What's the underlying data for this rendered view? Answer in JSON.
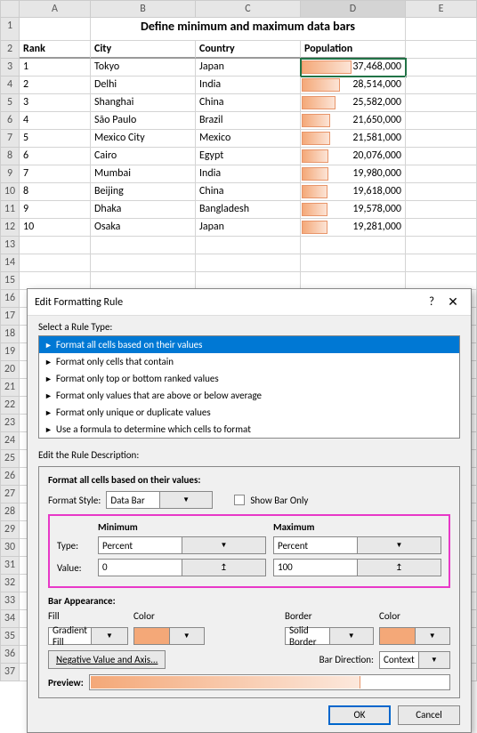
{
  "sheet": {
    "title": "Define minimum and maximum data bars",
    "cols": [
      "A",
      "B",
      "C",
      "D",
      "E"
    ],
    "headers": {
      "rank": "Rank",
      "city": "City",
      "country": "Country",
      "pop": "Population"
    },
    "rows": [
      {
        "n": "1",
        "rank": "1",
        "city": "Tokyo",
        "country": "Japan",
        "pop": "37,468,000",
        "bar": 100
      },
      {
        "n": "2",
        "rank": "2",
        "city": "Delhi",
        "country": "India",
        "pop": "28,514,000",
        "bar": 76
      },
      {
        "n": "3",
        "rank": "3",
        "city": "Shanghai",
        "country": "China",
        "pop": "25,582,000",
        "bar": 68
      },
      {
        "n": "4",
        "rank": "4",
        "city": "São Paulo",
        "country": "Brazil",
        "pop": "21,650,000",
        "bar": 58
      },
      {
        "n": "5",
        "rank": "5",
        "city": "Mexico City",
        "country": "Mexico",
        "pop": "21,581,000",
        "bar": 58
      },
      {
        "n": "6",
        "rank": "6",
        "city": "Cairo",
        "country": "Egypt",
        "pop": "20,076,000",
        "bar": 54
      },
      {
        "n": "7",
        "rank": "7",
        "city": "Mumbai",
        "country": "India",
        "pop": "19,980,000",
        "bar": 53
      },
      {
        "n": "8",
        "rank": "8",
        "city": "Beijing",
        "country": "China",
        "pop": "19,618,000",
        "bar": 52
      },
      {
        "n": "9",
        "rank": "9",
        "city": "Dhaka",
        "country": "Bangladesh",
        "pop": "19,578,000",
        "bar": 52
      },
      {
        "n": "10",
        "rank": "10",
        "city": "Osaka",
        "country": "Japan",
        "pop": "19,281,000",
        "bar": 51
      }
    ],
    "extra_rows": [
      "13",
      "14",
      "15",
      "16",
      "17",
      "18",
      "19",
      "20",
      "21",
      "22",
      "23",
      "24",
      "25",
      "26",
      "27",
      "28",
      "29",
      "30",
      "31",
      "32",
      "33",
      "34",
      "35",
      "36",
      "37"
    ]
  },
  "dialog": {
    "title": "Edit Formatting Rule",
    "help": "?",
    "close": "✕",
    "select_label": "Select a Rule Type:",
    "rules": [
      "Format all cells based on their values",
      "Format only cells that contain",
      "Format only top or bottom ranked values",
      "Format only values that are above or below average",
      "Format only unique or duplicate values",
      "Use a formula to determine which cells to format"
    ],
    "edit_desc": "Edit the Rule Description:",
    "format_all": "Format all cells based on their values:",
    "format_style_lbl": "Format Style:",
    "format_style_val": "Data Bar",
    "show_bar_only": "Show Bar Only",
    "min_lbl": "Minimum",
    "max_lbl": "Maximum",
    "type_lbl": "Type:",
    "value_lbl": "Value:",
    "type_min": "Percent",
    "type_max": "Percent",
    "val_min": "0",
    "val_max": "100",
    "bar_app": "Bar Appearance:",
    "fill_lbl": "Fill",
    "color_lbl": "Color",
    "border_lbl": "Border",
    "fill_val": "Gradient Fill",
    "border_val": "Solid Border",
    "neg_btn": "Negative Value and Axis...",
    "bar_dir_lbl": "Bar Direction:",
    "bar_dir_val": "Context",
    "preview_lbl": "Preview:",
    "ok": "OK",
    "cancel": "Cancel"
  },
  "chart_data": {
    "type": "bar",
    "title": "Define minimum and maximum data bars",
    "categories": [
      "Tokyo",
      "Delhi",
      "Shanghai",
      "São Paulo",
      "Mexico City",
      "Cairo",
      "Mumbai",
      "Beijing",
      "Dhaka",
      "Osaka"
    ],
    "values": [
      37468000,
      28514000,
      25582000,
      21650000,
      21581000,
      20076000,
      19980000,
      19618000,
      19578000,
      19281000
    ],
    "xlabel": "Population",
    "ylabel": "City"
  }
}
